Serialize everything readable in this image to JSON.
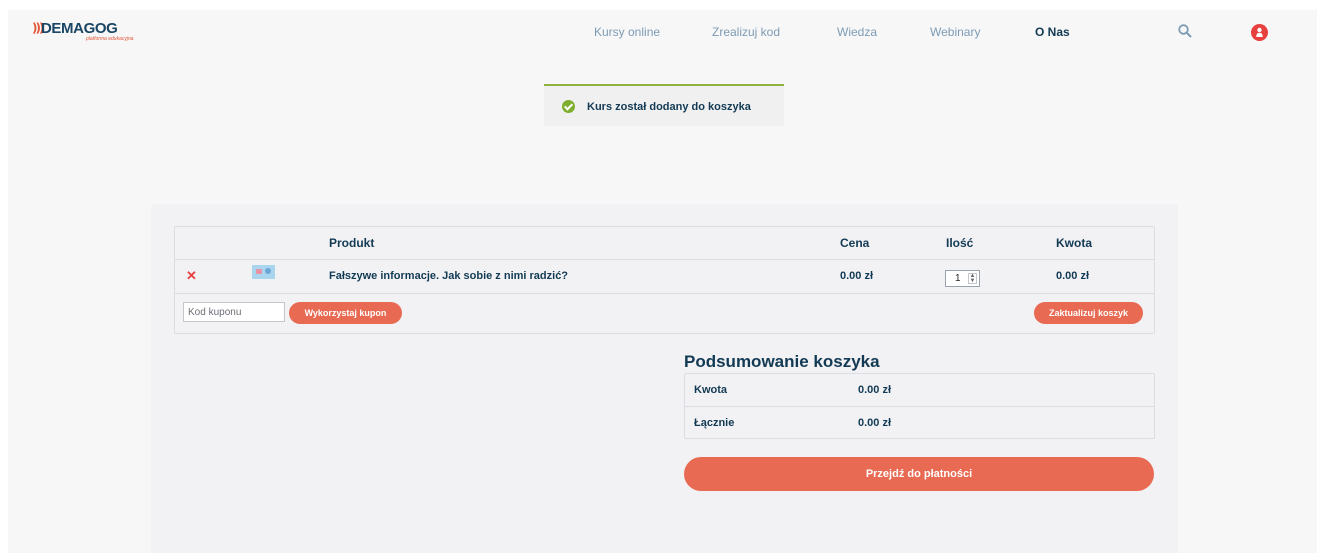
{
  "header": {
    "logo_text": "DEMAGOG",
    "logo_sub": "platforma edukacyjna",
    "nav": [
      {
        "label": "Kursy online"
      },
      {
        "label": "Zrealizuj kod"
      },
      {
        "label": "Wiedza"
      },
      {
        "label": "Webinary"
      },
      {
        "label": "O Nas"
      }
    ],
    "search_icon": "search-icon",
    "user_icon": "user-icon"
  },
  "notice": {
    "text": "Kurs został dodany do koszyka",
    "icon": "check-circle-icon"
  },
  "cart": {
    "columns": {
      "product": "Produkt",
      "price": "Cena",
      "quantity": "Ilość",
      "amount": "Kwota"
    },
    "items": [
      {
        "name": "Fałszywe informacje. Jak sobie z nimi radzić?",
        "price": "0.00 zł",
        "quantity": "1",
        "amount": "0.00 zł"
      }
    ],
    "coupon_placeholder": "Kod kuponu",
    "apply_coupon": "Wykorzystaj kupon",
    "update_cart": "Zaktualizuj koszyk"
  },
  "totals": {
    "title": "Podsumowanie koszyka",
    "subtotal_label": "Kwota",
    "subtotal_value": "0.00 zł",
    "total_label": "Łącznie",
    "total_value": "0.00 zł",
    "checkout": "Przejdź do płatności"
  },
  "colors": {
    "accent": "#e86a52",
    "navy": "#123a54",
    "success": "#7fae2f",
    "remove": "#e8403f"
  }
}
